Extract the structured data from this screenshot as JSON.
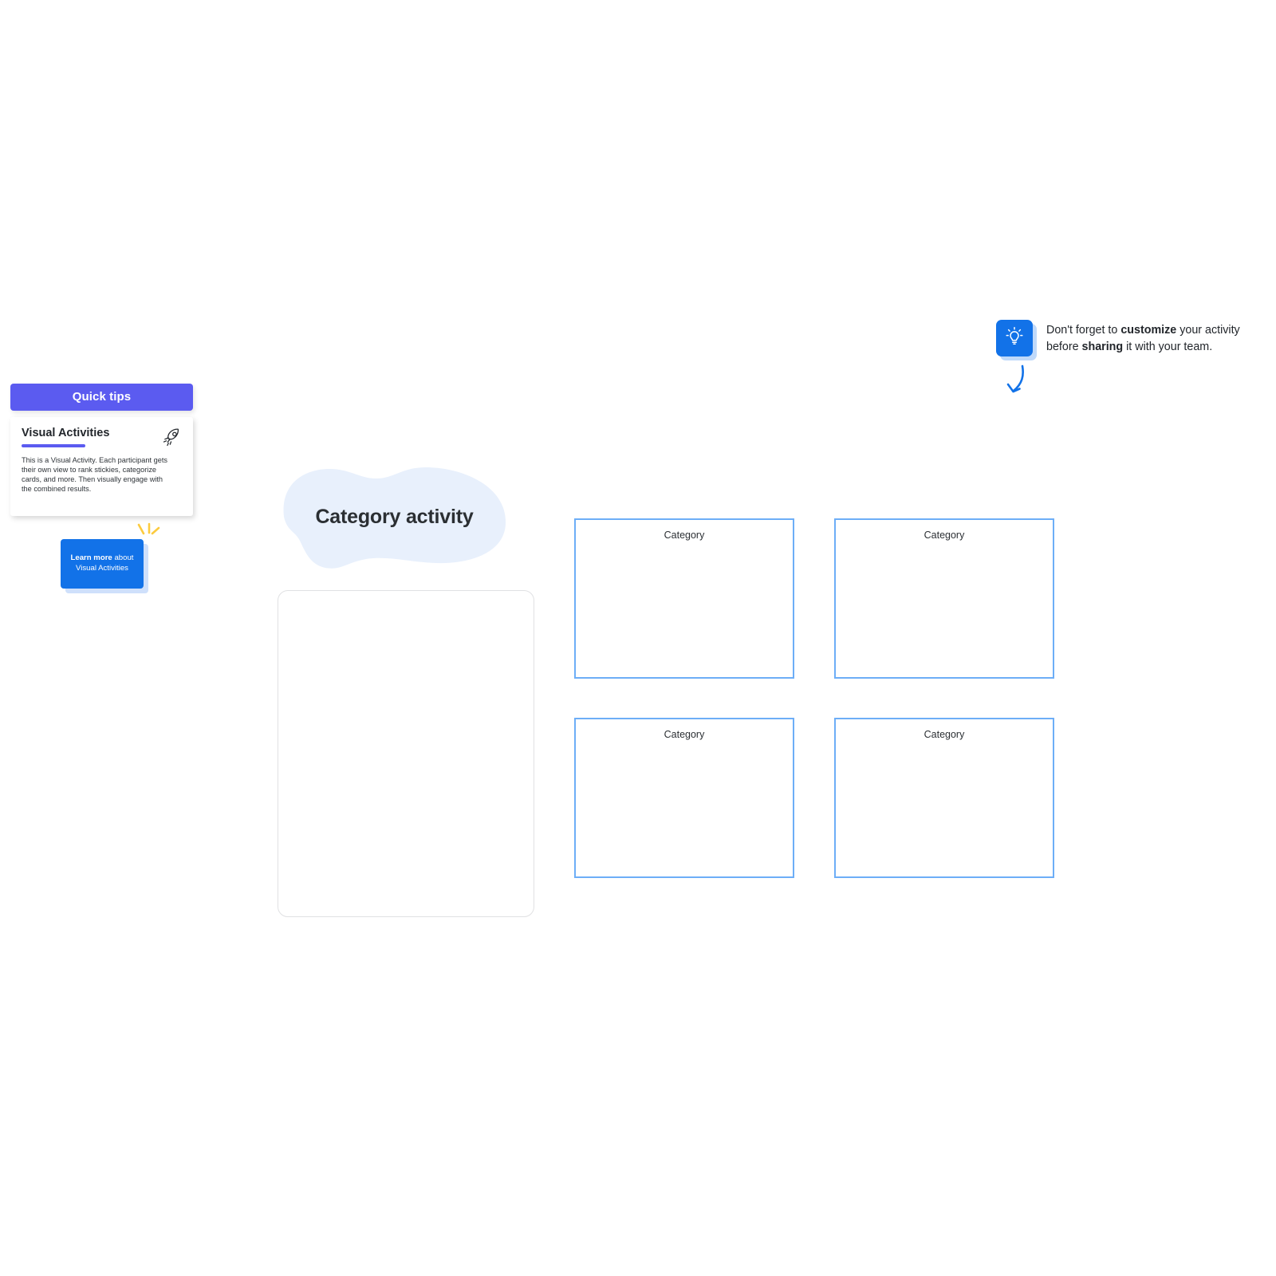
{
  "quick_tips": {
    "header_label": "Quick tips",
    "card": {
      "title": "Visual Activities",
      "body": "This is a Visual Activity. Each participant gets their own view to rank stickies, categorize cards, and more. Then visually engage with the combined results.",
      "icon": "rocket-icon"
    },
    "learn_more": {
      "strong_label": "Learn more",
      "rest_label": " about",
      "second_line": "Visual Activities"
    },
    "sparkle_icon": "sparkle-icon",
    "accent_color": "#5b5bf0"
  },
  "board": {
    "activity_title": "Category activity",
    "blob_color": "#e8f0fc",
    "stickies_card": {
      "label": "stickies-area"
    },
    "category_border_color": "#6daef7",
    "categories": [
      {
        "label": "Category"
      },
      {
        "label": "Category"
      },
      {
        "label": "Category"
      },
      {
        "label": "Category"
      }
    ]
  },
  "customize_tip": {
    "icon": "lightbulb-icon",
    "text_line_1_prefix": "Don't forget to ",
    "text_line_1_bold": "customize",
    "text_line_1_suffix": " your activity",
    "text_line_2_prefix": "before ",
    "text_line_2_bold": "sharing",
    "text_line_2_suffix": " it with your team.",
    "badge_color": "#1272e8",
    "arrow_icon": "curved-arrow-down-icon"
  }
}
